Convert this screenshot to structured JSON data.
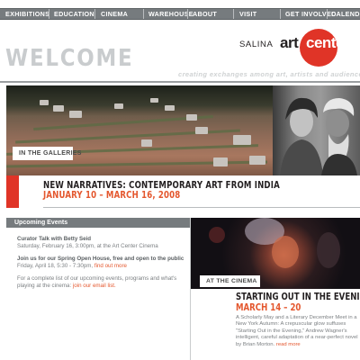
{
  "nav": {
    "items": [
      "EXHIBITIONS",
      "EDUCATION",
      "CINEMA",
      "WAREHOUSE",
      "ABOUT",
      "VISIT",
      "GET INVOLVED",
      "CALENDAR"
    ]
  },
  "logo": {
    "prefix": "SALINA",
    "art": "art",
    "center": "center"
  },
  "welcome": {
    "title": "WELCOME",
    "tagline": "creating exchanges among art, artists and audiences that reward"
  },
  "hero": {
    "tag": "IN THE GALLERIES"
  },
  "feature": {
    "title": "NEW NARRATIVES: CONTEMPORARY ART FROM INDIA",
    "dates": "JANUARY 10 – MARCH 16, 2008"
  },
  "events": {
    "heading": "Upcoming Events",
    "items": [
      {
        "title": "Curator Talk with Betty Seid",
        "detail": "Saturday, February 16, 3:00pm, at the Art Center Cinema",
        "link": ""
      },
      {
        "title": "Join us for our Spring Open House, free and open to the public",
        "detail": "Friday, April 18, 5:30 - 7:30pm,",
        "link": "find out more"
      },
      {
        "title": "",
        "detail": "For a complete list of our upcoming events, programs and what's playing at the cinema:",
        "link": "join our email list."
      }
    ]
  },
  "cinema": {
    "tag": "AT THE CINEMA",
    "title": "STARTING OUT IN THE EVENING",
    "dates": "MARCH 14 – 20",
    "description": "A Scholarly May and a Literary December Meet in a New York Autumn: A crepuscular glow suffuses \"Starting Out in the Evening,\" Andrew Wagner's intelligent, careful adaptation of a near-perfect novel by Brian Morton.",
    "link": "read more"
  },
  "colors": {
    "nav_bg": "#767b7e",
    "accent_red": "#e03427",
    "date_orange": "#e4572e",
    "welcome_gray": "#c9ccce",
    "body_text": "#7b7f82"
  }
}
